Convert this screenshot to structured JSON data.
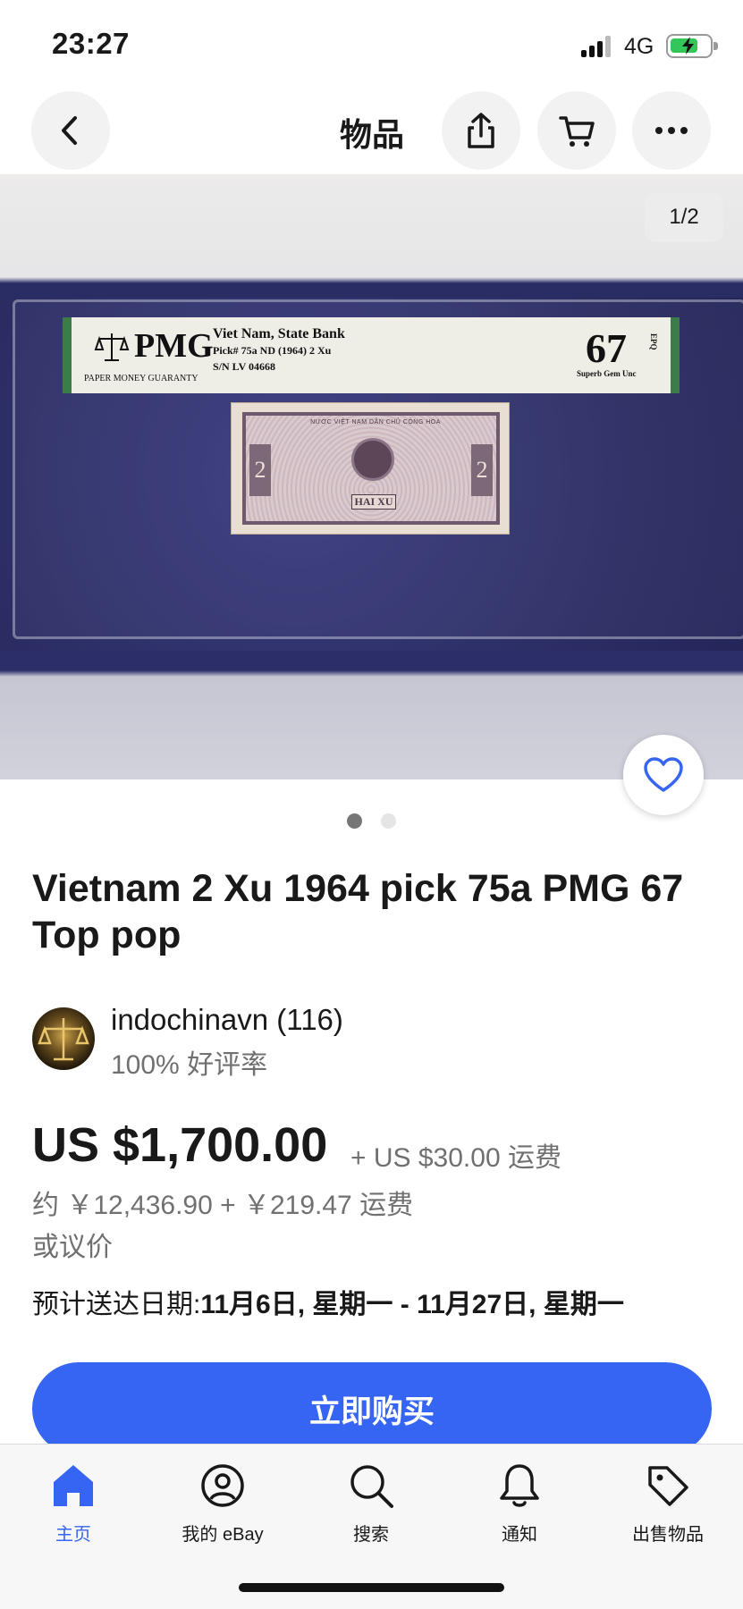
{
  "status_bar": {
    "time": "23:27",
    "network": "4G"
  },
  "header": {
    "title": "物品",
    "back_icon": "chevron-left-icon",
    "share_icon": "share-icon",
    "cart_icon": "cart-icon",
    "more_icon": "more-icon"
  },
  "gallery": {
    "counter": "1/2",
    "total_images": 2,
    "current_index": 1,
    "label": {
      "brand": "PMG",
      "brand_sub": "PAPER MONEY GUARANTY",
      "line1": "Viet Nam, State Bank",
      "line2": "Pick# 75a  ND (1964)  2 Xu",
      "line3": "S/N LV 04668",
      "grade": "67",
      "grade_desc": "Superb Gem Unc",
      "epq": "EPQ"
    },
    "banknote": {
      "top_text": "NƯỚC VIỆT NAM DÂN CHỦ CỘNG HÒA",
      "denomination": "2",
      "name": "HAI XU"
    }
  },
  "item": {
    "title": "Vietnam 2 Xu 1964 pick 75a PMG 67 Top pop"
  },
  "seller": {
    "name": "indochinavn (116)",
    "rating": "100% 好评率"
  },
  "pricing": {
    "price": "US $1,700.00",
    "shipping": "+ US $30.00 运费",
    "approx": "约 ￥12,436.90 + ￥219.47 运费",
    "best_offer": "或议价"
  },
  "delivery": {
    "label": "预计送达日期:",
    "range": "11月6日, 星期一 - 11月27日, 星期一"
  },
  "actions": {
    "buy_now": "立即购买"
  },
  "tab_bar": {
    "items": [
      {
        "label": "主页",
        "icon": "home-icon",
        "active": true
      },
      {
        "label": "我的 eBay",
        "icon": "user-icon",
        "active": false
      },
      {
        "label": "搜索",
        "icon": "search-icon",
        "active": false
      },
      {
        "label": "通知",
        "icon": "bell-icon",
        "active": false
      },
      {
        "label": "出售物品",
        "icon": "tag-icon",
        "active": false
      }
    ]
  },
  "colors": {
    "accent": "#3665f3",
    "text_primary": "#191919",
    "text_secondary": "#707070"
  }
}
